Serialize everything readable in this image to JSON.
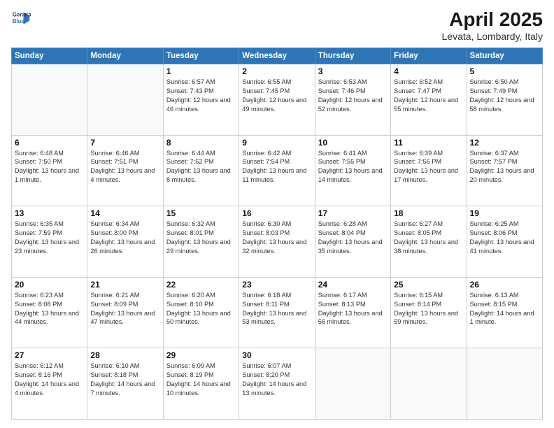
{
  "header": {
    "logo_line1": "General",
    "logo_line2": "Blue",
    "title": "April 2025",
    "subtitle": "Levata, Lombardy, Italy"
  },
  "weekdays": [
    "Sunday",
    "Monday",
    "Tuesday",
    "Wednesday",
    "Thursday",
    "Friday",
    "Saturday"
  ],
  "weeks": [
    [
      {
        "day": "",
        "info": ""
      },
      {
        "day": "",
        "info": ""
      },
      {
        "day": "1",
        "info": "Sunrise: 6:57 AM\nSunset: 7:43 PM\nDaylight: 12 hours and 46 minutes."
      },
      {
        "day": "2",
        "info": "Sunrise: 6:55 AM\nSunset: 7:45 PM\nDaylight: 12 hours and 49 minutes."
      },
      {
        "day": "3",
        "info": "Sunrise: 6:53 AM\nSunset: 7:46 PM\nDaylight: 12 hours and 52 minutes."
      },
      {
        "day": "4",
        "info": "Sunrise: 6:52 AM\nSunset: 7:47 PM\nDaylight: 12 hours and 55 minutes."
      },
      {
        "day": "5",
        "info": "Sunrise: 6:50 AM\nSunset: 7:49 PM\nDaylight: 12 hours and 58 minutes."
      }
    ],
    [
      {
        "day": "6",
        "info": "Sunrise: 6:48 AM\nSunset: 7:50 PM\nDaylight: 13 hours and 1 minute."
      },
      {
        "day": "7",
        "info": "Sunrise: 6:46 AM\nSunset: 7:51 PM\nDaylight: 13 hours and 4 minutes."
      },
      {
        "day": "8",
        "info": "Sunrise: 6:44 AM\nSunset: 7:52 PM\nDaylight: 13 hours and 8 minutes."
      },
      {
        "day": "9",
        "info": "Sunrise: 6:42 AM\nSunset: 7:54 PM\nDaylight: 13 hours and 11 minutes."
      },
      {
        "day": "10",
        "info": "Sunrise: 6:41 AM\nSunset: 7:55 PM\nDaylight: 13 hours and 14 minutes."
      },
      {
        "day": "11",
        "info": "Sunrise: 6:39 AM\nSunset: 7:56 PM\nDaylight: 13 hours and 17 minutes."
      },
      {
        "day": "12",
        "info": "Sunrise: 6:37 AM\nSunset: 7:57 PM\nDaylight: 13 hours and 20 minutes."
      }
    ],
    [
      {
        "day": "13",
        "info": "Sunrise: 6:35 AM\nSunset: 7:59 PM\nDaylight: 13 hours and 23 minutes."
      },
      {
        "day": "14",
        "info": "Sunrise: 6:34 AM\nSunset: 8:00 PM\nDaylight: 13 hours and 26 minutes."
      },
      {
        "day": "15",
        "info": "Sunrise: 6:32 AM\nSunset: 8:01 PM\nDaylight: 13 hours and 29 minutes."
      },
      {
        "day": "16",
        "info": "Sunrise: 6:30 AM\nSunset: 8:03 PM\nDaylight: 13 hours and 32 minutes."
      },
      {
        "day": "17",
        "info": "Sunrise: 6:28 AM\nSunset: 8:04 PM\nDaylight: 13 hours and 35 minutes."
      },
      {
        "day": "18",
        "info": "Sunrise: 6:27 AM\nSunset: 8:05 PM\nDaylight: 13 hours and 38 minutes."
      },
      {
        "day": "19",
        "info": "Sunrise: 6:25 AM\nSunset: 8:06 PM\nDaylight: 13 hours and 41 minutes."
      }
    ],
    [
      {
        "day": "20",
        "info": "Sunrise: 6:23 AM\nSunset: 8:08 PM\nDaylight: 13 hours and 44 minutes."
      },
      {
        "day": "21",
        "info": "Sunrise: 6:21 AM\nSunset: 8:09 PM\nDaylight: 13 hours and 47 minutes."
      },
      {
        "day": "22",
        "info": "Sunrise: 6:20 AM\nSunset: 8:10 PM\nDaylight: 13 hours and 50 minutes."
      },
      {
        "day": "23",
        "info": "Sunrise: 6:18 AM\nSunset: 8:11 PM\nDaylight: 13 hours and 53 minutes."
      },
      {
        "day": "24",
        "info": "Sunrise: 6:17 AM\nSunset: 8:13 PM\nDaylight: 13 hours and 56 minutes."
      },
      {
        "day": "25",
        "info": "Sunrise: 6:15 AM\nSunset: 8:14 PM\nDaylight: 13 hours and 59 minutes."
      },
      {
        "day": "26",
        "info": "Sunrise: 6:13 AM\nSunset: 8:15 PM\nDaylight: 14 hours and 1 minute."
      }
    ],
    [
      {
        "day": "27",
        "info": "Sunrise: 6:12 AM\nSunset: 8:16 PM\nDaylight: 14 hours and 4 minutes."
      },
      {
        "day": "28",
        "info": "Sunrise: 6:10 AM\nSunset: 8:18 PM\nDaylight: 14 hours and 7 minutes."
      },
      {
        "day": "29",
        "info": "Sunrise: 6:09 AM\nSunset: 8:19 PM\nDaylight: 14 hours and 10 minutes."
      },
      {
        "day": "30",
        "info": "Sunrise: 6:07 AM\nSunset: 8:20 PM\nDaylight: 14 hours and 13 minutes."
      },
      {
        "day": "",
        "info": ""
      },
      {
        "day": "",
        "info": ""
      },
      {
        "day": "",
        "info": ""
      }
    ]
  ]
}
